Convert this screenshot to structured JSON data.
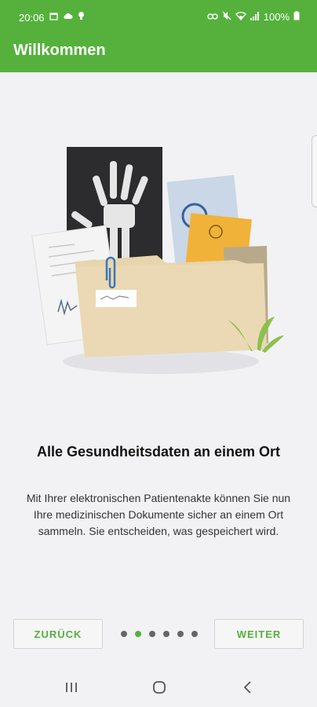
{
  "status_bar": {
    "time": "20:06",
    "battery_text": "100%",
    "left_icons": [
      "calendar-icon",
      "cloud-icon",
      "bulb-icon"
    ],
    "right_icons": [
      "link-icon",
      "mute-icon",
      "wifi-icon",
      "signal-icon",
      "battery-icon"
    ]
  },
  "app_bar": {
    "title": "Willkommen"
  },
  "onboarding": {
    "headline": "Alle Gesundheitsdaten an einem Ort",
    "body": "Mit Ihrer elektronischen Patientenakte können Sie nun Ihre medizinischen Dokumente sicher an einem Ort sammeln. Sie entscheiden, was gespeichert wird."
  },
  "pager": {
    "total_pages": 6,
    "current_page": 2
  },
  "buttons": {
    "back_label": "ZURÜCK",
    "next_label": "WEITER"
  },
  "colors": {
    "accent": "#55b13c",
    "background": "#f2f2f4"
  },
  "nav_bar": {
    "icons": [
      "recents-icon",
      "home-icon",
      "back-icon"
    ]
  }
}
